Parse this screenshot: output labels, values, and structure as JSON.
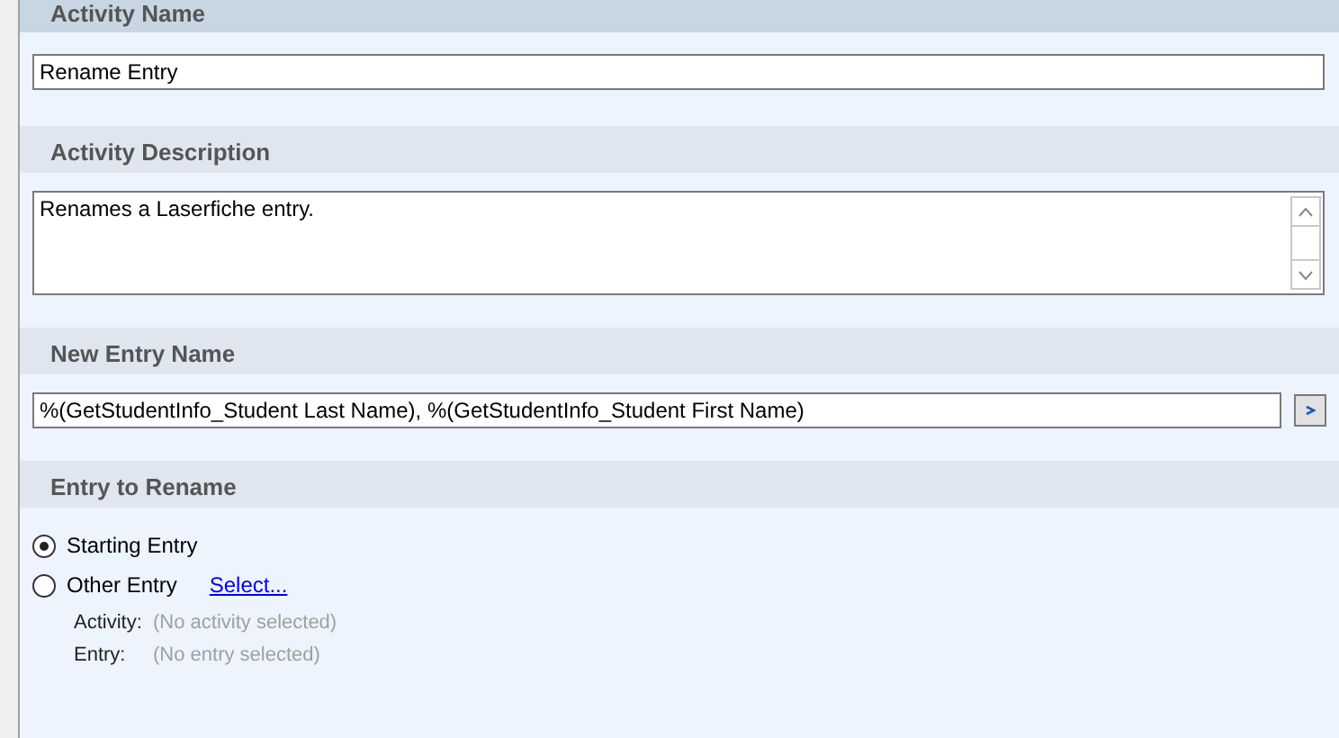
{
  "sections": [
    {
      "title": "Activity Name",
      "highlighted": true,
      "kind": "text",
      "value": "Rename Entry"
    },
    {
      "title": "Activity Description",
      "highlighted": false,
      "kind": "textarea",
      "value": "Renames a Laserfiche entry."
    },
    {
      "title": "New Entry Name",
      "highlighted": false,
      "kind": "expression",
      "value": "%(GetStudentInfo_Student Last Name), %(GetStudentInfo_Student First Name)"
    },
    {
      "title": "Entry to Rename",
      "highlighted": false,
      "kind": "choice",
      "options": [
        {
          "label": "Starting Entry",
          "selected": true
        },
        {
          "label": "Other Entry",
          "selected": false,
          "link": "Select..."
        }
      ],
      "details": [
        {
          "label": "Activity:",
          "value": "(No activity selected)"
        },
        {
          "label": "Entry:",
          "value": "(No entry selected)"
        }
      ]
    }
  ]
}
